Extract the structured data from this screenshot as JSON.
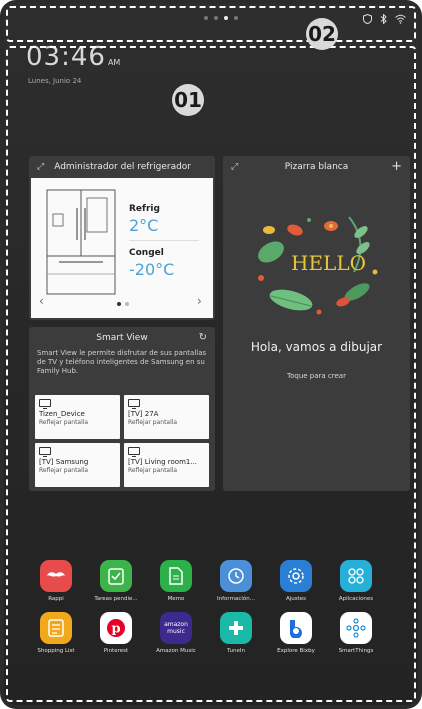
{
  "annotations": {
    "main_area": "01",
    "status_bar": "02"
  },
  "clock": {
    "time": "03:46",
    "ampm": "AM",
    "date": "Lunes, Junio 24"
  },
  "fridge_manager": {
    "title": "Administrador del refrigerador",
    "fridge_label": "Refrig",
    "fridge_temp": "2°C",
    "freezer_label": "Congel",
    "freezer_temp": "-20°C"
  },
  "smart_view": {
    "title": "Smart View",
    "description": "Smart View le permite disfrutar de sus pantallas de TV y teléfono inteligentes de Samsung en su Family Hub.",
    "devices": [
      {
        "name": "Tizen_Device",
        "action": "Reflejar pantalla"
      },
      {
        "name": "[TV] 27A",
        "action": "Reflejar pantalla"
      },
      {
        "name": "[TV] Samsung",
        "action": "Reflejar pantalla"
      },
      {
        "name": "[TV] Living room1...",
        "action": "Reflejar pantalla"
      }
    ]
  },
  "whiteboard": {
    "title": "Pizarra blanca",
    "hello": "HELLO",
    "greeting": "Hola, vamos a dibujar",
    "cta": "Toque para crear"
  },
  "apps": [
    {
      "label": "Rappi",
      "color": "#e84b4b",
      "icon": "mustache-icon"
    },
    {
      "label": "Tareas pendie...",
      "color": "#3cb44a",
      "icon": "checklist-icon"
    },
    {
      "label": "Memo",
      "color": "#2bb04a",
      "icon": "note-icon"
    },
    {
      "label": "Información...",
      "color": "#4a8fd8",
      "icon": "clock-info-icon"
    },
    {
      "label": "Ajustes",
      "color": "#2a7fd4",
      "icon": "gear-icon"
    },
    {
      "label": "Aplicaciones",
      "color": "#26b0d8",
      "icon": "apps-grid-icon"
    },
    {
      "label": "Shopping List",
      "color": "#f2a81d",
      "icon": "shopping-list-icon"
    },
    {
      "label": "Pinterest",
      "color": "#ffffff",
      "icon": "pinterest-icon"
    },
    {
      "label": "Amazon Music",
      "color": "#3d2a8f",
      "icon": "amazon-music-icon",
      "text": "amazon music"
    },
    {
      "label": "TuneIn",
      "color": "#1ab9a8",
      "icon": "tunein-icon"
    },
    {
      "label": "Explore Bixby",
      "color": "#ffffff",
      "icon": "bixby-icon"
    },
    {
      "label": "SmartThings",
      "color": "#ffffff",
      "icon": "smartthings-icon"
    }
  ]
}
